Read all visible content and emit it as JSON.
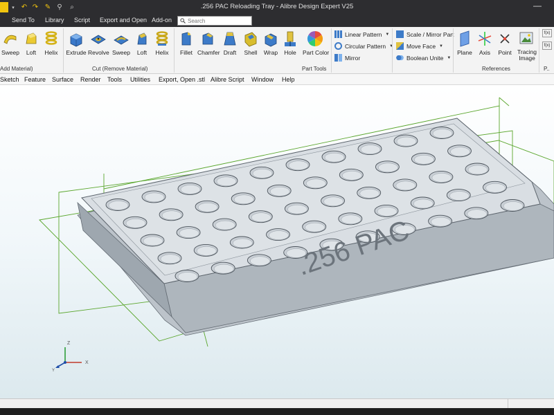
{
  "window": {
    "title": ".256 PAC Reloading Tray - Alibre Design Expert V25",
    "minimize_glyph": "—"
  },
  "tabs": [
    {
      "label": "Send To"
    },
    {
      "label": "Library"
    },
    {
      "label": "Script"
    },
    {
      "label": "Export and Open"
    },
    {
      "label": "Add-on"
    }
  ],
  "search": {
    "placeholder": "Search"
  },
  "ribbon": {
    "add_group": {
      "label": "Add Material)",
      "buttons": [
        {
          "label": "Sweep"
        },
        {
          "label": "Loft"
        },
        {
          "label": "Helix"
        }
      ]
    },
    "cut_group": {
      "label": "Cut (Remove Material)",
      "buttons": [
        {
          "label": "Extrude"
        },
        {
          "label": "Revolve"
        },
        {
          "label": "Sweep"
        },
        {
          "label": "Loft"
        },
        {
          "label": "Helix"
        }
      ]
    },
    "tools_group": {
      "label": "Part Tools",
      "buttons": [
        {
          "label": "Fillet"
        },
        {
          "label": "Chamfer"
        },
        {
          "label": "Draft"
        },
        {
          "label": "Shell"
        },
        {
          "label": "Wrap"
        },
        {
          "label": "Hole"
        },
        {
          "label": "Part Color"
        }
      ],
      "pattern_items": [
        {
          "label": "Linear Pattern"
        },
        {
          "label": "Circular Pattern"
        },
        {
          "label": "Mirror"
        }
      ],
      "modify_items": [
        {
          "label": "Scale / Mirror Part"
        },
        {
          "label": "Move Face"
        },
        {
          "label": "Boolean Unite"
        }
      ]
    },
    "ref_group": {
      "label": "References",
      "buttons": [
        {
          "label": "Plane"
        },
        {
          "label": "Axis"
        },
        {
          "label": "Point"
        },
        {
          "label": "Tracing Image"
        }
      ]
    },
    "overflow_label": "P..",
    "side_icons": [
      {
        "label": "f(x)"
      },
      {
        "label": "f(x)"
      }
    ]
  },
  "menubar": [
    {
      "label": "Sketch"
    },
    {
      "label": "Feature"
    },
    {
      "label": "Surface"
    },
    {
      "label": "Render"
    },
    {
      "label": "Tools"
    },
    {
      "label": "Utilities"
    },
    {
      "label": "Export, Open .stl"
    },
    {
      "label": "Alibre Script"
    },
    {
      "label": "Window"
    },
    {
      "label": "Help"
    }
  ],
  "model": {
    "engraving": ".256 PAC",
    "rows": 5,
    "cols": 10
  },
  "triad": {
    "x": "X",
    "y": "Y",
    "z": "Z"
  },
  "colors": {
    "titlebar": "#2d2d30",
    "ribbon": "#f3f3f3",
    "reference_plane": "#5aa62c",
    "tray_top": "#d9dee3",
    "tray_side": "#b8bfc6"
  }
}
